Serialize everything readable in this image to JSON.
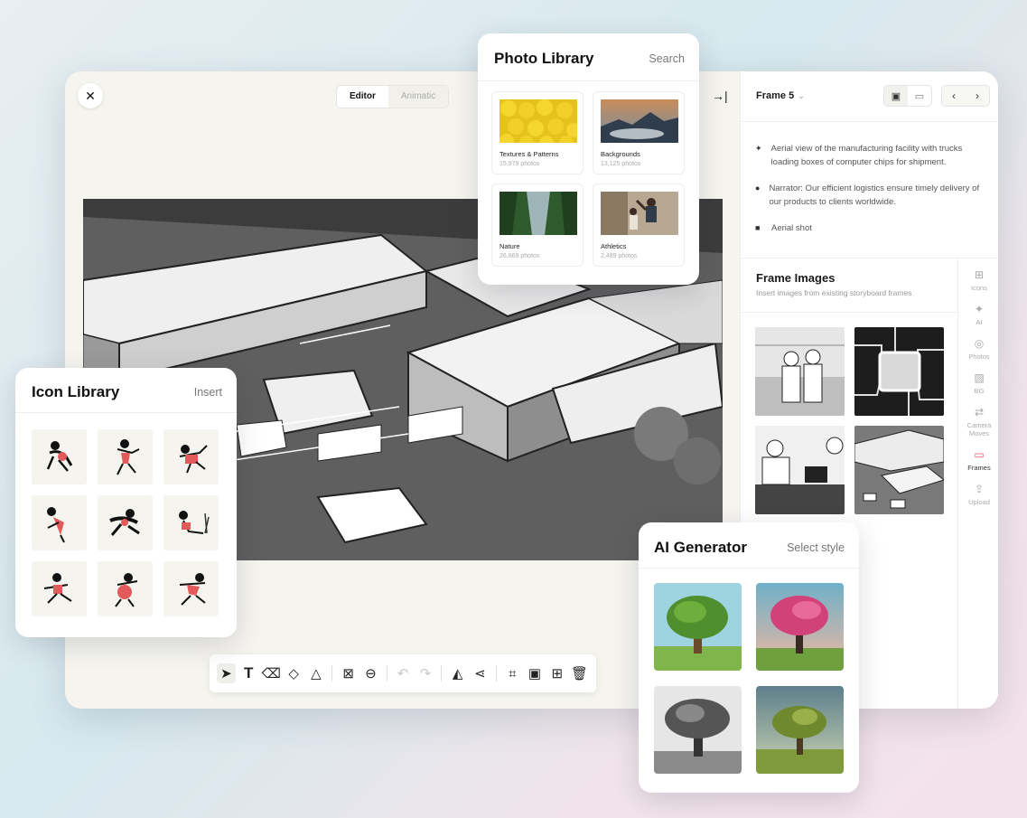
{
  "editor": {
    "close_label": "✕",
    "modes": [
      "Editor",
      "Animatic"
    ],
    "active_mode": "Editor",
    "collapse_icon": "→|"
  },
  "toolbar": {
    "tools": [
      {
        "icon": "pointer-icon",
        "glyph": "➤",
        "state": "selected"
      },
      {
        "icon": "text-icon",
        "glyph": "T",
        "state": "normal"
      },
      {
        "icon": "eraser-icon",
        "glyph": "⌫",
        "state": "normal"
      },
      {
        "icon": "fill-icon",
        "glyph": "◇",
        "state": "normal"
      },
      {
        "icon": "shapes-icon",
        "glyph": "△",
        "state": "normal"
      },
      {
        "icon": "remove-background-icon",
        "glyph": "⊠",
        "state": "normal"
      },
      {
        "icon": "merge-icon",
        "glyph": "⊖",
        "state": "normal"
      },
      {
        "icon": "undo-icon",
        "glyph": "↶",
        "state": "disabled"
      },
      {
        "icon": "redo-icon",
        "glyph": "↷",
        "state": "disabled"
      },
      {
        "icon": "flip-icon",
        "glyph": "◭",
        "state": "normal"
      },
      {
        "icon": "skew-icon",
        "glyph": "⋖",
        "state": "normal"
      },
      {
        "icon": "crop-icon",
        "glyph": "⌗",
        "state": "normal"
      },
      {
        "icon": "image-icon",
        "glyph": "▣",
        "state": "normal"
      },
      {
        "icon": "add-layer-icon",
        "glyph": "⊞",
        "state": "normal"
      },
      {
        "icon": "trash-icon",
        "glyph": "🗑",
        "state": "normal"
      }
    ]
  },
  "frame_panel": {
    "title": "Frame 5",
    "chevron": "⌄",
    "notes": [
      {
        "icon": "action-icon",
        "glyph": "🏃",
        "text": "Aerial view of the manufacturing facility with trucks loading boxes of computer chips for shipment."
      },
      {
        "icon": "microphone-icon",
        "glyph": "🎙",
        "text": "Narrator: Our efficient logistics ensure timely delivery of our products to clients worldwide."
      },
      {
        "icon": "camera-icon",
        "glyph": "■",
        "text": "Aerial shot"
      }
    ],
    "frame_images_title": "Frame Images",
    "frame_images_subtitle": "Insert images from existing storyboard frames",
    "rail": [
      {
        "icon": "grid-icon",
        "glyph": "⊞",
        "label": "Icons"
      },
      {
        "icon": "sparkle-icon",
        "glyph": "✦",
        "label": "AI"
      },
      {
        "icon": "camera-outline-icon",
        "glyph": "◎",
        "label": "Photos"
      },
      {
        "icon": "background-icon",
        "glyph": "▨",
        "label": "BG"
      },
      {
        "icon": "camera-moves-icon",
        "glyph": "⇄",
        "label": "Camera Moves"
      },
      {
        "icon": "frames-icon",
        "glyph": "▭",
        "label": "Frames",
        "active": true
      },
      {
        "icon": "upload-icon",
        "glyph": "⇪",
        "label": "Upload"
      }
    ]
  },
  "photo_library": {
    "title": "Photo Library",
    "action": "Search",
    "categories": [
      {
        "name": "Textures & Patterns",
        "count": "15,979 photos"
      },
      {
        "name": "Backgrounds",
        "count": "13,125 photos"
      },
      {
        "name": "Nature",
        "count": "26,869 photos"
      },
      {
        "name": "Athletics",
        "count": "2,489 photos"
      }
    ]
  },
  "icon_library": {
    "title": "Icon Library",
    "action": "Insert"
  },
  "ai_generator": {
    "title": "AI Generator",
    "action": "Select style"
  },
  "colors": {
    "accent_red": "#e25a5a",
    "panel_bg": "#ffffff",
    "canvas_bg": "#f5f4ef"
  }
}
